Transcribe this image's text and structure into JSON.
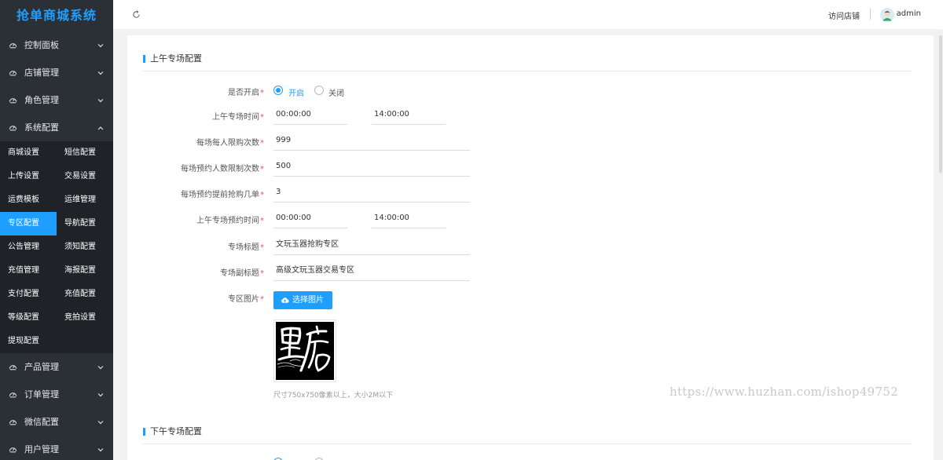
{
  "app": {
    "title": "抢单商城系统"
  },
  "sidebar": {
    "menus_top": [
      {
        "label": "控制面板",
        "icon": "dashboard-icon",
        "expanded": false
      },
      {
        "label": "店铺管理",
        "icon": "dashboard-icon",
        "expanded": false
      },
      {
        "label": "角色管理",
        "icon": "dashboard-icon",
        "expanded": false
      },
      {
        "label": "系统配置",
        "icon": "dashboard-icon",
        "expanded": true
      }
    ],
    "submenu": [
      {
        "label": "商城设置"
      },
      {
        "label": "短信配置"
      },
      {
        "label": "上传设置"
      },
      {
        "label": "交易设置"
      },
      {
        "label": "运费模板"
      },
      {
        "label": "运维管理"
      },
      {
        "label": "专区配置",
        "active": true
      },
      {
        "label": "导航配置"
      },
      {
        "label": "公告管理"
      },
      {
        "label": "须知配置"
      },
      {
        "label": "充值管理"
      },
      {
        "label": "海报配置"
      },
      {
        "label": "支付配置"
      },
      {
        "label": "充值配置"
      },
      {
        "label": "等级配置"
      },
      {
        "label": "竞拍设置"
      },
      {
        "label": "提现配置"
      }
    ],
    "menus_bottom": [
      {
        "label": "产品管理",
        "icon": "dashboard-icon"
      },
      {
        "label": "订单管理",
        "icon": "dashboard-icon"
      },
      {
        "label": "微信配置",
        "icon": "dashboard-icon"
      },
      {
        "label": "用户管理",
        "icon": "dashboard-icon"
      }
    ]
  },
  "header": {
    "visit_store": "访问店铺",
    "separator": "|",
    "username": "admin"
  },
  "morning": {
    "section_title": "上午专场配置",
    "enabled": {
      "label": "是否开启",
      "options": [
        "开启",
        "关闭"
      ],
      "selected": "开启"
    },
    "session_time": {
      "label": "上午专场时间",
      "start": "00:00:00",
      "end": "14:00:00"
    },
    "per_user_limit": {
      "label": "每场每人限购次数",
      "value": "999"
    },
    "reserve_user_limit": {
      "label": "每场预约人数限制次数",
      "value": "500"
    },
    "reserve_ahead": {
      "label": "每场预约提前抢购几单",
      "value": "3"
    },
    "reserve_time": {
      "label": "上午专场预约时间",
      "start": "00:00:00",
      "end": "14:00:00"
    },
    "zone_title": {
      "label": "专场标题",
      "value": "文玩玉器抢购专区"
    },
    "zone_subtitle": {
      "label": "专场副标题",
      "value": "高级文玩玉器交易专区"
    },
    "zone_image": {
      "label": "专区图片",
      "button": "选择图片",
      "preview_text": "里店",
      "hint": "尺寸750x750像素以上，大小2M以下"
    }
  },
  "afternoon": {
    "section_title": "下午专场配置"
  },
  "required_mark": "*",
  "watermark": "https://www.huzhan.com/ishop49752",
  "colors": {
    "accent": "#1e9fff",
    "sidebar_bg": "#2b3036",
    "submenu_bg": "#1f2328",
    "required": "#ff4d4f"
  }
}
